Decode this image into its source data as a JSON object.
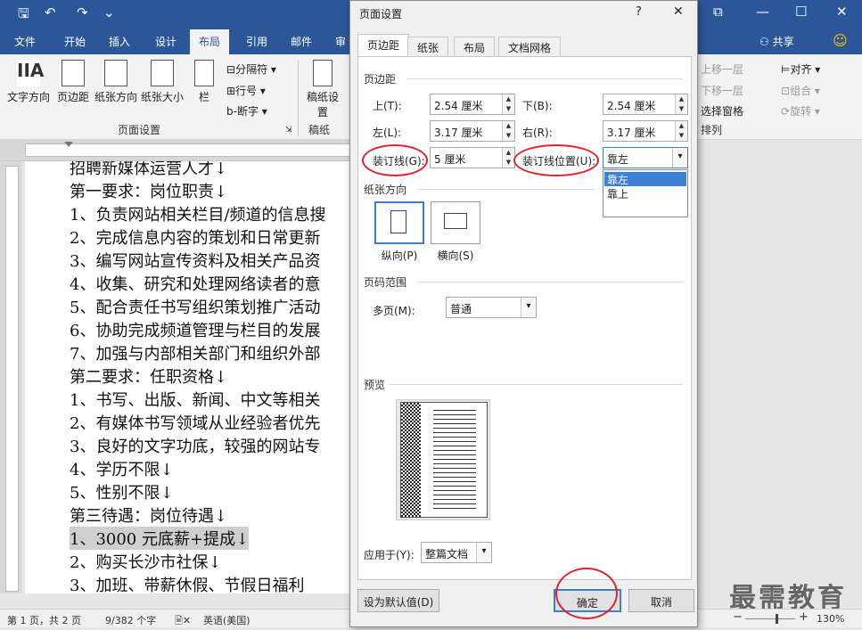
{
  "titlebar": {
    "save_icon": "save-icon",
    "undo_icon": "undo-icon",
    "redo_icon": "redo-icon",
    "more_icon": "customize-icon",
    "restore_icon": "restore-icon",
    "minimize": "—",
    "maximize": "☐",
    "close": "✕"
  },
  "tabs": [
    "文件",
    "开始",
    "插入",
    "设计",
    "布局",
    "引用",
    "邮件",
    "审"
  ],
  "share": "共享",
  "ribbon": {
    "text_direction": "文字方向",
    "margins": "页边距",
    "orientation": "纸张方向",
    "size": "纸张大小",
    "columns": "栏",
    "breaks": "分隔符",
    "line_numbers": "行号",
    "hyphenation": "断字",
    "group_page_setup": "页面设置",
    "draft": "稿纸设置",
    "group_draft": "稿纸",
    "bring_forward": "上移一层",
    "send_backward": "下移一层",
    "selection_pane": "选择窗格",
    "align": "对齐",
    "group": "组合",
    "rotate": "旋转",
    "group_arrange": "排列"
  },
  "document": {
    "lines": [
      "招聘新媒体运营人才↓",
      "第一要求：岗位职责↓",
      "1、负责网站相关栏目/频道的信息搜",
      "2、完成信息内容的策划和日常更新",
      "3、编写网站宣传资料及相关产品资",
      "4、收集、研究和处理网络读者的意",
      "5、配合责任书写组织策划推广活动",
      "6、协助完成频道管理与栏目的发展",
      "7、加强与内部相关部门和组织外部",
      "第二要求：任职资格↓",
      "1、书写、出版、新闻、中文等相关",
      "2、有媒体书写领域从业经验者优先",
      "3、良好的文字功底，较强的网站专",
      "4、学历不限↓",
      "5、性别不限↓",
      "第三待遇：岗位待遇↓",
      "1、3000 元底薪+提成↓",
      "2、购买长沙市社保↓",
      "3、加班、带薪休假、节假日福利"
    ]
  },
  "status": {
    "page": "第 1 页，共 2 页",
    "words": "9/382 个字",
    "lang": "英语(美国)",
    "zoom": "130%",
    "zoom_fraction": 0.62
  },
  "dialog": {
    "title": "页面设置",
    "help": "?",
    "close": "✕",
    "tabs": [
      "页边距",
      "纸张",
      "布局",
      "文档网格"
    ],
    "margins_section": "页边距",
    "top_label": "上(T):",
    "top_value": "2.54 厘米",
    "bottom_label": "下(B):",
    "bottom_value": "2.54 厘米",
    "left_label": "左(L):",
    "left_value": "3.17 厘米",
    "right_label": "右(R):",
    "right_value": "3.17 厘米",
    "gutter_label": "装订线(G):",
    "gutter_value": "5 厘米",
    "gutter_pos_label": "装订线位置(U):",
    "gutter_pos_value": "靠左",
    "gutter_pos_options": [
      "靠左",
      "靠上"
    ],
    "orientation_section": "纸张方向",
    "portrait": "纵向(P)",
    "landscape": "横向(S)",
    "pages_section": "页码范围",
    "multiple_label": "多页(M):",
    "multiple_value": "普通",
    "preview_section": "预览",
    "apply_label": "应用于(Y):",
    "apply_value": "整篇文档",
    "default_btn": "设为默认值(D)",
    "ok_btn": "确定",
    "cancel_btn": "取消"
  },
  "watermark": "最需教育",
  "colors": {
    "brand": "#2b579a",
    "highlight": "#e4202a",
    "selection": "#3b7fd6"
  }
}
